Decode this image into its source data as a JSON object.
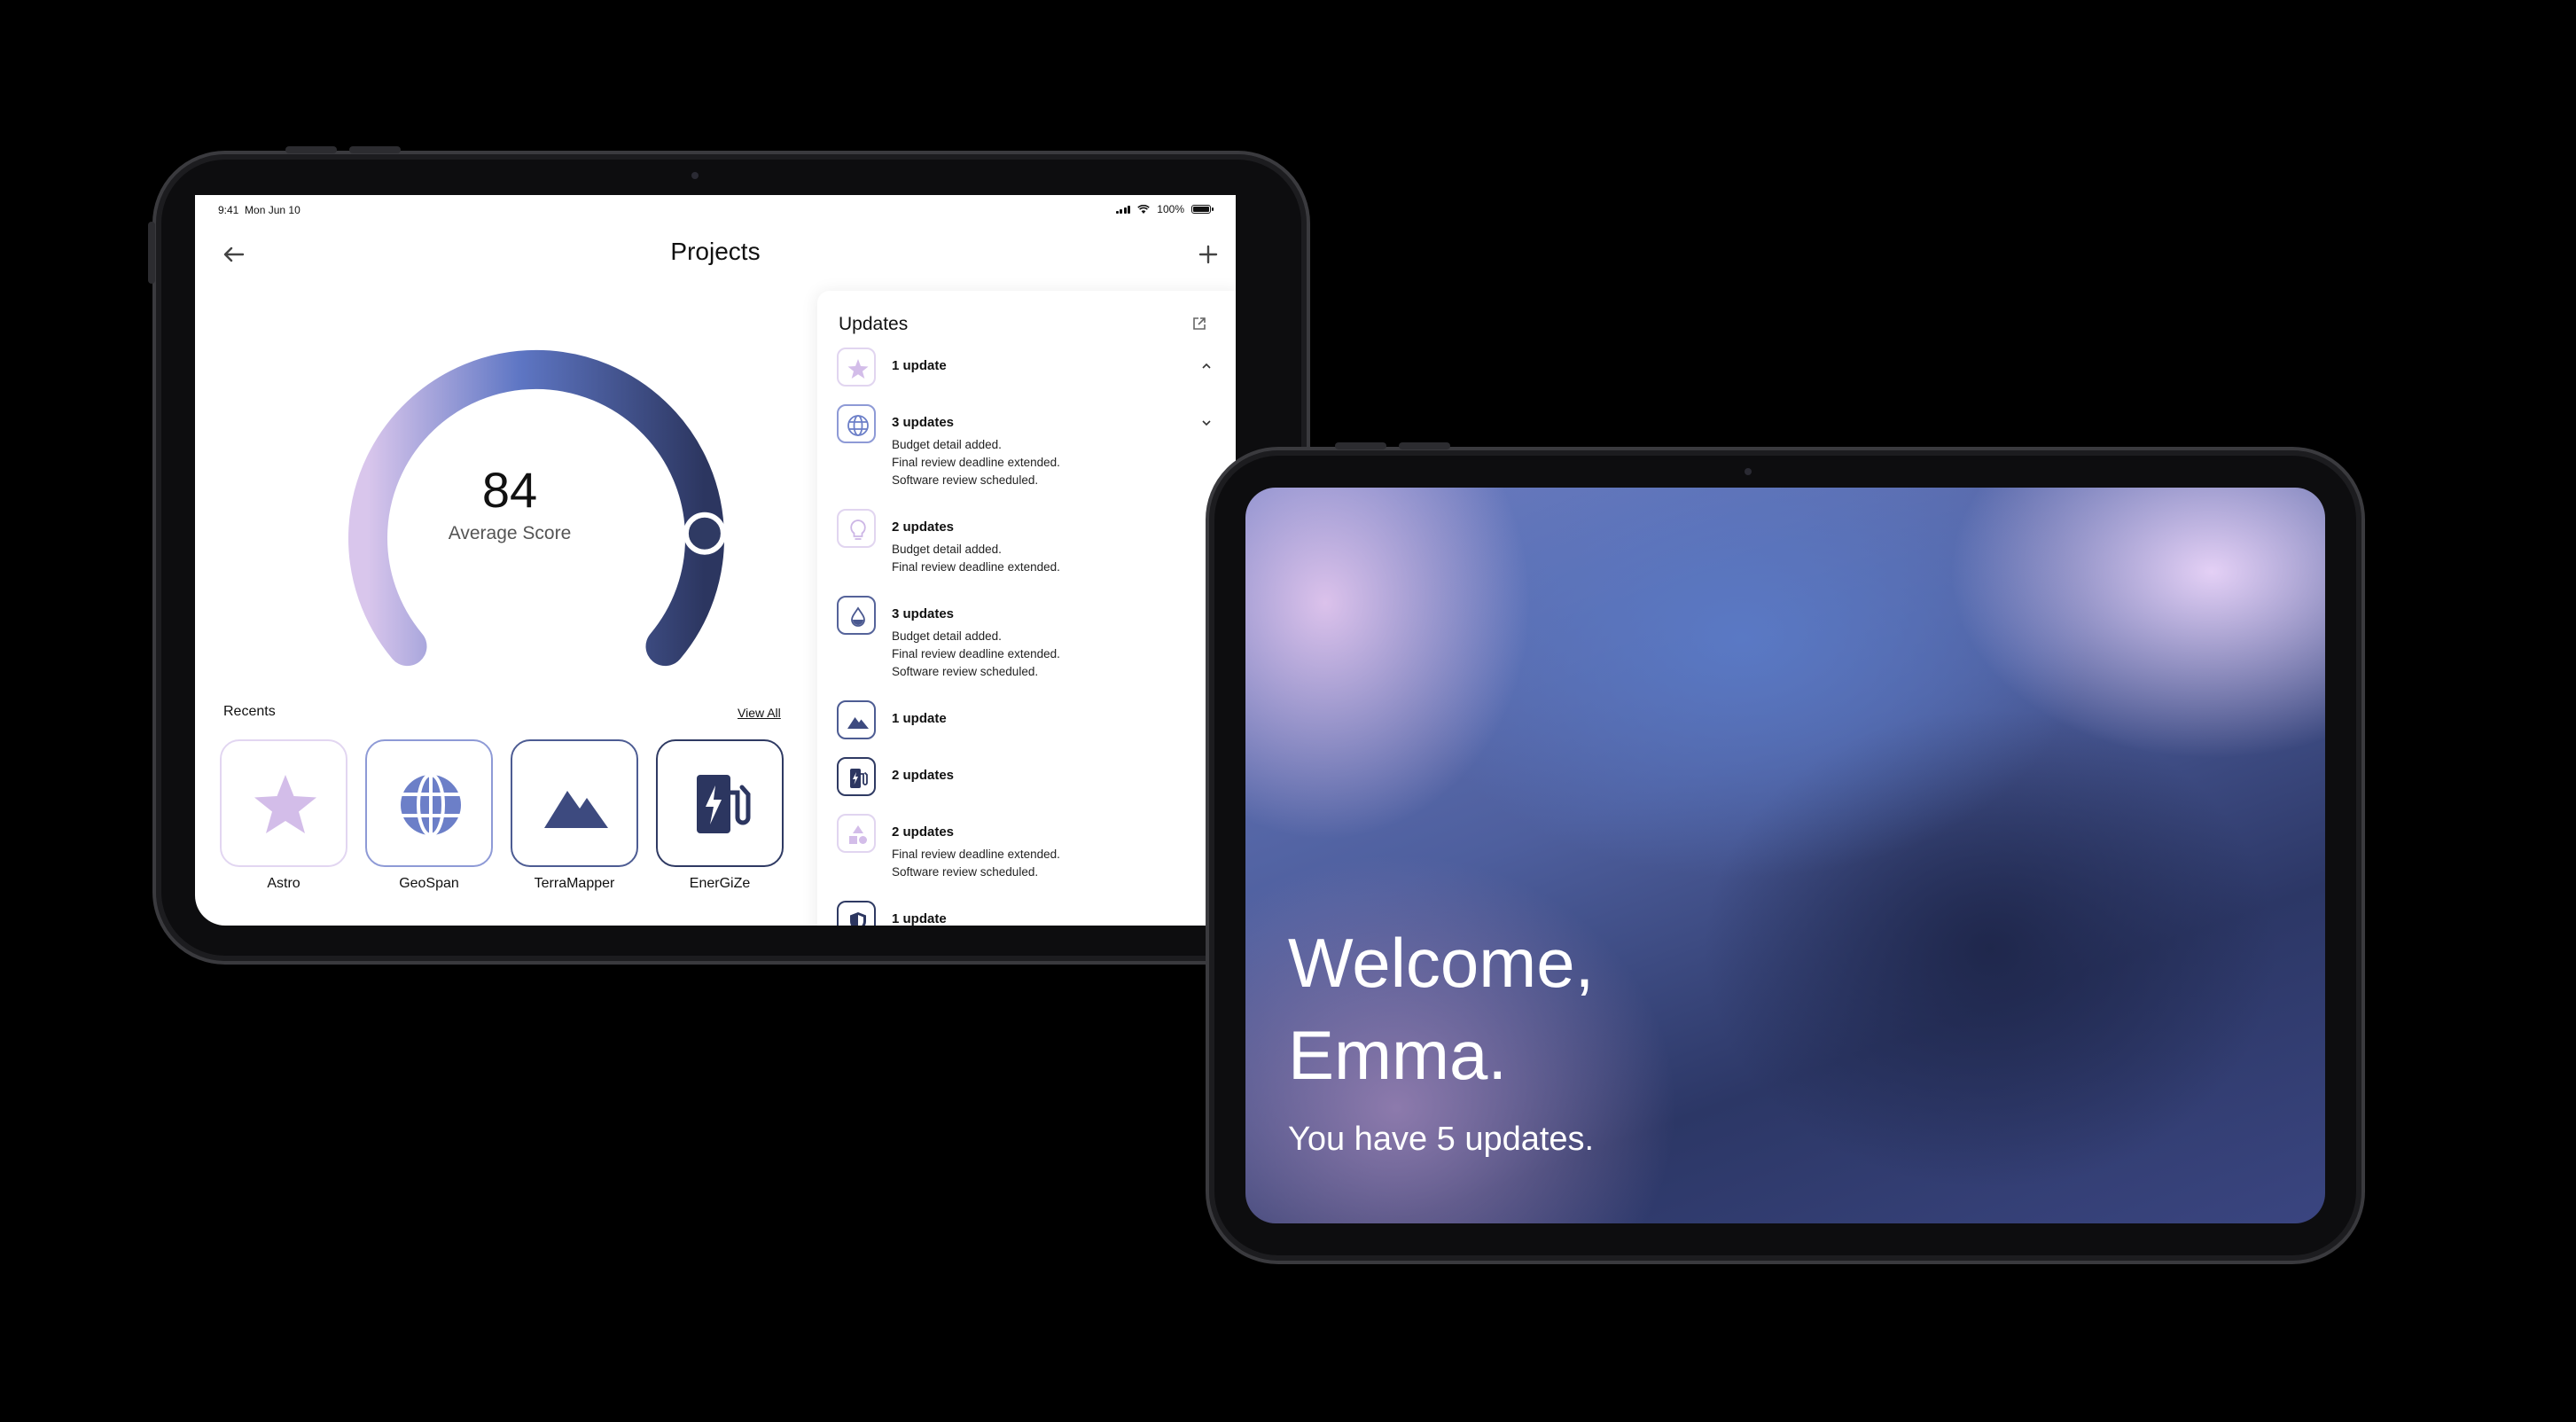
{
  "status_bar": {
    "time": "9:41",
    "date": "Mon Jun 10",
    "battery": "100%"
  },
  "projects": {
    "title": "Projects",
    "gauge": {
      "score": "84",
      "label": "Average Score",
      "value": 84,
      "max": 100
    },
    "recents": {
      "title": "Recents",
      "view_all": "View All",
      "items": [
        {
          "label": "Astro",
          "icon": "star-icon"
        },
        {
          "label": "GeoSpan",
          "icon": "globe-icon"
        },
        {
          "label": "TerraMapper",
          "icon": "mountain-icon"
        },
        {
          "label": "EnerGiZe",
          "icon": "ev-charger-icon"
        }
      ]
    },
    "updates": {
      "title": "Updates",
      "items": [
        {
          "icon": "star-icon",
          "title": "1 update",
          "lines": [],
          "state": "expanded"
        },
        {
          "icon": "globe-icon",
          "title": "3 updates",
          "lines": [
            "Budget detail added.",
            "Final review deadline extended.",
            "Software review scheduled."
          ],
          "state": "collapsed"
        },
        {
          "icon": "lightbulb-icon",
          "title": "2 updates",
          "lines": [
            "Budget detail added.",
            "Final review deadline extended."
          ],
          "state": ""
        },
        {
          "icon": "water-drop-icon",
          "title": "3 updates",
          "lines": [
            "Budget detail added.",
            "Final review deadline extended.",
            "Software review scheduled."
          ],
          "state": ""
        },
        {
          "icon": "mountain-icon",
          "title": "1 update",
          "lines": [],
          "state": ""
        },
        {
          "icon": "ev-charger-icon",
          "title": "2 updates",
          "lines": [],
          "state": ""
        },
        {
          "icon": "shapes-icon",
          "title": "2 updates",
          "lines": [
            "Final review deadline extended.",
            "Software review scheduled."
          ],
          "state": ""
        },
        {
          "icon": "shield-icon",
          "title": "1 update",
          "lines": [],
          "state": ""
        }
      ]
    }
  },
  "welcome": {
    "line1": "Welcome,",
    "line2": "Emma.",
    "subtitle": "You have 5 updates."
  },
  "colors": {
    "lavender": "#d5c2ea",
    "periwinkle": "#7b89cf",
    "blue": "#5a72bf",
    "navy": "#2f3a63"
  }
}
